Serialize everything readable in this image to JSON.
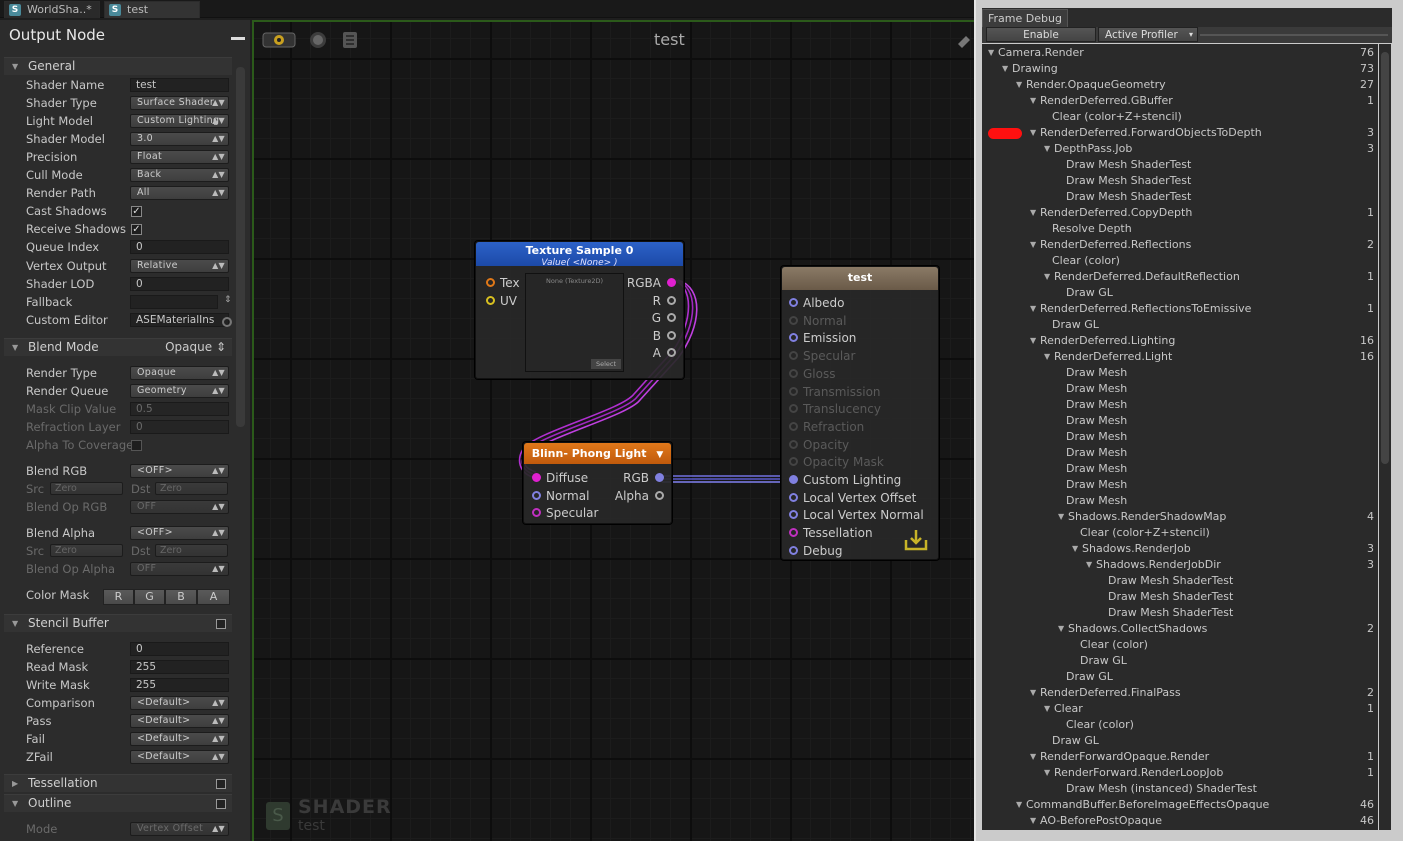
{
  "tabs": [
    {
      "label": "WorldSha..*",
      "icon": "shader-icon"
    },
    {
      "label": "test",
      "icon": "shader-icon"
    }
  ],
  "inspector": {
    "title": "Output Node",
    "general_label": "General",
    "properties": [
      {
        "label": "Shader Name",
        "value": "test",
        "kind": "field"
      },
      {
        "label": "Shader Type",
        "value": "Surface Shader",
        "kind": "dropdown"
      },
      {
        "label": "Light Model",
        "value": "Custom Lighting",
        "kind": "dropdown"
      },
      {
        "label": "Shader Model",
        "value": "3.0",
        "kind": "dropdown"
      },
      {
        "label": "Precision",
        "value": "Float",
        "kind": "dropdown"
      },
      {
        "label": "Cull Mode",
        "value": "Back",
        "kind": "dropdown"
      },
      {
        "label": "Render Path",
        "value": "All",
        "kind": "dropdown"
      },
      {
        "label": "Cast Shadows",
        "value": "✓",
        "kind": "check"
      },
      {
        "label": "Receive Shadows",
        "value": "✓",
        "kind": "check"
      },
      {
        "label": "Queue Index",
        "value": "0",
        "kind": "field"
      },
      {
        "label": "Vertex Output",
        "value": "Relative",
        "kind": "dropdown"
      },
      {
        "label": "Shader LOD",
        "value": "0",
        "kind": "field"
      },
      {
        "label": "Fallback",
        "value": "",
        "kind": "field"
      },
      {
        "label": "Custom Editor",
        "value": "ASEMaterialIns",
        "kind": "field"
      }
    ],
    "blend_mode_label": "Blend Mode",
    "blend_mode_value": "Opaque",
    "blend_props": [
      {
        "label": "Render Type",
        "value": "Opaque",
        "kind": "dropdown",
        "dim": false
      },
      {
        "label": "Render Queue",
        "value": "Geometry",
        "kind": "dropdown",
        "dim": false
      },
      {
        "label": "Mask Clip Value",
        "value": "0.5",
        "kind": "field",
        "dim": true
      },
      {
        "label": "Refraction Layer",
        "value": "0",
        "kind": "field",
        "dim": true
      },
      {
        "label": "Alpha To Coverage",
        "value": "",
        "kind": "check",
        "dim": true
      }
    ],
    "blend_rgb_label": "Blend RGB",
    "blend_rgb_value": "<OFF>",
    "src_label": "Src",
    "dst_label": "Dst",
    "zero": "Zero",
    "blend_op_rgb_label": "Blend Op RGB",
    "off": "OFF",
    "blend_alpha_label": "Blend Alpha",
    "blend_alpha_value": "<OFF>",
    "blend_op_alpha_label": "Blend Op Alpha",
    "color_mask_label": "Color Mask",
    "color_mask": [
      "R",
      "G",
      "B",
      "A"
    ],
    "stencil_label": "Stencil Buffer",
    "stencil_props": [
      {
        "label": "Reference",
        "value": "0",
        "kind": "field"
      },
      {
        "label": "Read Mask",
        "value": "255",
        "kind": "field"
      },
      {
        "label": "Write Mask",
        "value": "255",
        "kind": "field"
      },
      {
        "label": "Comparison",
        "value": "<Default>",
        "kind": "dropdown"
      },
      {
        "label": "Pass",
        "value": "<Default>",
        "kind": "dropdown"
      },
      {
        "label": "Fail",
        "value": "<Default>",
        "kind": "dropdown"
      },
      {
        "label": "ZFail",
        "value": "<Default>",
        "kind": "dropdown"
      }
    ],
    "tessellation_label": "Tessellation",
    "outline_label": "Outline",
    "mode_label": "Mode",
    "mode_value": "Vertex Offset"
  },
  "canvas": {
    "title": "test",
    "logo_big": "SHADER",
    "logo_small": "test"
  },
  "nodes": {
    "texture": {
      "title": "Texture Sample 0",
      "subtitle": "Value( <None> )",
      "inputs": [
        "Tex",
        "UV"
      ],
      "outputs": [
        "RGBA",
        "R",
        "G",
        "B",
        "A"
      ],
      "preview_label": "None (Texture2D)",
      "select_label": "Select"
    },
    "blinn": {
      "title": "Blinn- Phong Light",
      "inputs": [
        "Diffuse",
        "Normal",
        "Specular"
      ],
      "outputs": [
        "RGB",
        "Alpha"
      ]
    },
    "output": {
      "title": "test",
      "inputs": [
        "Albedo",
        "Normal",
        "Emission",
        "Specular",
        "Gloss",
        "Transmission",
        "Translucency",
        "Refraction",
        "Opacity",
        "Opacity Mask",
        "Custom Lighting",
        "Local Vertex Offset",
        "Local Vertex Normal",
        "Tessellation",
        "Debug"
      ]
    }
  },
  "profiler": {
    "tab": "Frame Debug",
    "enable": "Enable",
    "active_profiler": "Active Profiler",
    "rows": [
      {
        "d": 0,
        "t": "Camera.Render",
        "n": "76",
        "e": 1
      },
      {
        "d": 1,
        "t": "Drawing",
        "n": "73",
        "e": 1
      },
      {
        "d": 2,
        "t": "Render.OpaqueGeometry",
        "n": "27",
        "e": 1
      },
      {
        "d": 3,
        "t": "RenderDeferred.GBuffer",
        "n": "1",
        "e": 1
      },
      {
        "d": 4,
        "t": "Clear (color+Z+stencil)",
        "n": "",
        "e": 0
      },
      {
        "d": 3,
        "t": "RenderDeferred.ForwardObjectsToDepth",
        "n": "3",
        "e": 1
      },
      {
        "d": 4,
        "t": "DepthPass.Job",
        "n": "3",
        "e": 1
      },
      {
        "d": 5,
        "t": "Draw Mesh ShaderTest",
        "n": "",
        "e": 0
      },
      {
        "d": 5,
        "t": "Draw Mesh ShaderTest",
        "n": "",
        "e": 0
      },
      {
        "d": 5,
        "t": "Draw Mesh ShaderTest",
        "n": "",
        "e": 0
      },
      {
        "d": 3,
        "t": "RenderDeferred.CopyDepth",
        "n": "1",
        "e": 1
      },
      {
        "d": 4,
        "t": "Resolve Depth",
        "n": "",
        "e": 0
      },
      {
        "d": 3,
        "t": "RenderDeferred.Reflections",
        "n": "2",
        "e": 1
      },
      {
        "d": 4,
        "t": "Clear (color)",
        "n": "",
        "e": 0
      },
      {
        "d": 4,
        "t": "RenderDeferred.DefaultReflection",
        "n": "1",
        "e": 1
      },
      {
        "d": 5,
        "t": "Draw GL",
        "n": "",
        "e": 0
      },
      {
        "d": 3,
        "t": "RenderDeferred.ReflectionsToEmissive",
        "n": "1",
        "e": 1
      },
      {
        "d": 4,
        "t": "Draw GL",
        "n": "",
        "e": 0
      },
      {
        "d": 3,
        "t": "RenderDeferred.Lighting",
        "n": "16",
        "e": 1
      },
      {
        "d": 4,
        "t": "RenderDeferred.Light",
        "n": "16",
        "e": 1
      },
      {
        "d": 5,
        "t": "Draw Mesh",
        "n": "",
        "e": 0
      },
      {
        "d": 5,
        "t": "Draw Mesh",
        "n": "",
        "e": 0
      },
      {
        "d": 5,
        "t": "Draw Mesh",
        "n": "",
        "e": 0
      },
      {
        "d": 5,
        "t": "Draw Mesh",
        "n": "",
        "e": 0
      },
      {
        "d": 5,
        "t": "Draw Mesh",
        "n": "",
        "e": 0
      },
      {
        "d": 5,
        "t": "Draw Mesh",
        "n": "",
        "e": 0
      },
      {
        "d": 5,
        "t": "Draw Mesh",
        "n": "",
        "e": 0
      },
      {
        "d": 5,
        "t": "Draw Mesh",
        "n": "",
        "e": 0
      },
      {
        "d": 5,
        "t": "Draw Mesh",
        "n": "",
        "e": 0
      },
      {
        "d": 5,
        "t": "Shadows.RenderShadowMap",
        "n": "4",
        "e": 1
      },
      {
        "d": 6,
        "t": "Clear (color+Z+stencil)",
        "n": "",
        "e": 0
      },
      {
        "d": 6,
        "t": "Shadows.RenderJob",
        "n": "3",
        "e": 1
      },
      {
        "d": 7,
        "t": "Shadows.RenderJobDir",
        "n": "3",
        "e": 1
      },
      {
        "d": 8,
        "t": "Draw Mesh ShaderTest",
        "n": "",
        "e": 0
      },
      {
        "d": 8,
        "t": "Draw Mesh ShaderTest",
        "n": "",
        "e": 0
      },
      {
        "d": 8,
        "t": "Draw Mesh ShaderTest",
        "n": "",
        "e": 0
      },
      {
        "d": 5,
        "t": "Shadows.CollectShadows",
        "n": "2",
        "e": 1
      },
      {
        "d": 6,
        "t": "Clear (color)",
        "n": "",
        "e": 0
      },
      {
        "d": 6,
        "t": "Draw GL",
        "n": "",
        "e": 0
      },
      {
        "d": 5,
        "t": "Draw GL",
        "n": "",
        "e": 0
      },
      {
        "d": 3,
        "t": "RenderDeferred.FinalPass",
        "n": "2",
        "e": 1
      },
      {
        "d": 4,
        "t": "Clear",
        "n": "1",
        "e": 1
      },
      {
        "d": 5,
        "t": "Clear (color)",
        "n": "",
        "e": 0
      },
      {
        "d": 4,
        "t": "Draw GL",
        "n": "",
        "e": 0
      },
      {
        "d": 3,
        "t": "RenderForwardOpaque.Render",
        "n": "1",
        "e": 1
      },
      {
        "d": 4,
        "t": "RenderForward.RenderLoopJob",
        "n": "1",
        "e": 1
      },
      {
        "d": 5,
        "t": "Draw Mesh (instanced) ShaderTest",
        "n": "",
        "e": 0
      },
      {
        "d": 2,
        "t": "CommandBuffer.BeforeImageEffectsOpaque",
        "n": "46",
        "e": 1
      },
      {
        "d": 3,
        "t": "AO-BeforePostOpaque",
        "n": "46",
        "e": 1
      }
    ]
  },
  "colors": {
    "texture_header": "#2456b8",
    "blinn_header": "#d56a12",
    "output_header": "#7a6a58",
    "wire_purple": "#b030d0",
    "wire_blue": "#7070e0",
    "marker_red": "#ff1010"
  }
}
